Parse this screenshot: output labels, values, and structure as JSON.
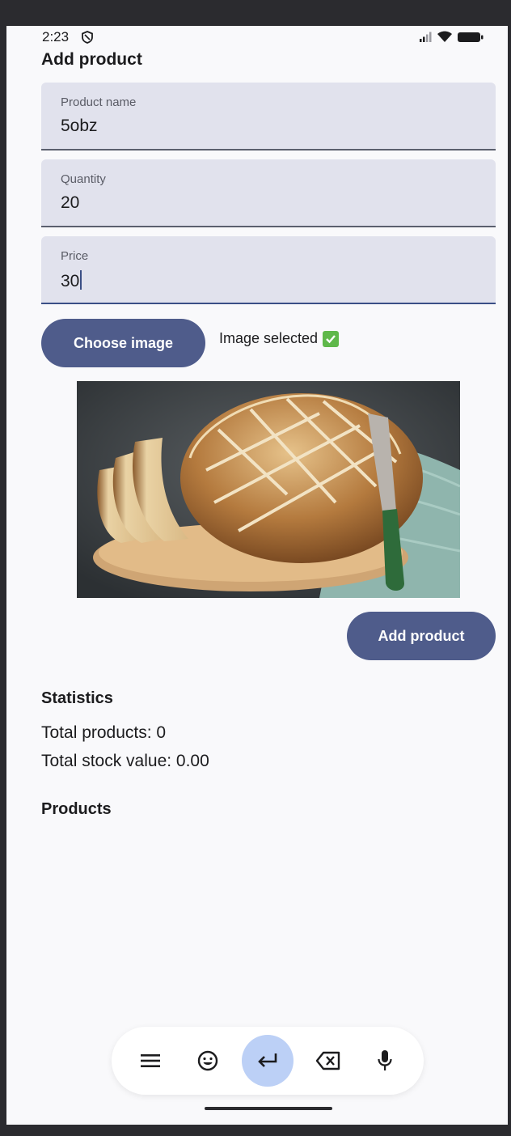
{
  "status_bar": {
    "time": "2:23"
  },
  "header": {
    "title": "Add product"
  },
  "form": {
    "name": {
      "label": "Product name",
      "value": "5obz"
    },
    "quantity": {
      "label": "Quantity",
      "value": "20"
    },
    "price": {
      "label": "Price",
      "value": "30"
    }
  },
  "image_picker": {
    "button_label": "Choose image",
    "status_text": "Image selected"
  },
  "actions": {
    "add_label": "Add product"
  },
  "statistics": {
    "title": "Statistics",
    "total_products": "Total products: 0",
    "total_stock_value": "Total stock value: 0.00"
  },
  "products": {
    "title": "Products"
  },
  "keyboard_toolbar": {
    "icons": [
      "menu-icon",
      "emoji-icon",
      "enter-icon",
      "backspace-icon",
      "microphone-icon"
    ]
  },
  "colors": {
    "primary": "#4f5c8b",
    "field_bg": "#e1e2ed",
    "screen_bg": "#f9f9fb",
    "accent_key": "#bcd0f6",
    "check": "#5fb84a"
  }
}
